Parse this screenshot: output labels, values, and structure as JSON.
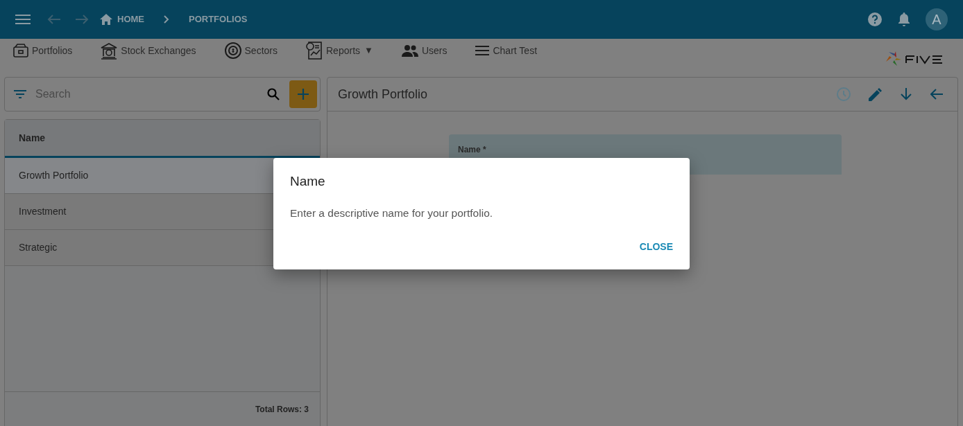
{
  "top_bar": {
    "breadcrumbs": [
      "HOME",
      "PORTFOLIOS"
    ],
    "avatar": "A"
  },
  "menu": [
    {
      "label": "Portfolios",
      "kind": "wallet",
      "dropdown": false
    },
    {
      "label": "Stock Exchanges",
      "kind": "bank",
      "dropdown": false
    },
    {
      "label": "Sectors",
      "kind": "sectors",
      "dropdown": false
    },
    {
      "label": "Reports",
      "kind": "report",
      "dropdown": true,
      "caret": "▼"
    },
    {
      "label": "Users",
      "kind": "users",
      "dropdown": false
    },
    {
      "label": "Chart Test",
      "kind": "lines",
      "dropdown": false
    }
  ],
  "list": {
    "search": {
      "placeholder": "Search"
    },
    "columns": [
      "Name"
    ],
    "rows": [
      {
        "name": "Growth Portfolio",
        "selected": true
      },
      {
        "name": "Investment",
        "selected": false
      },
      {
        "name": "Strategic",
        "selected": false
      }
    ],
    "footer": "Total Rows: 3"
  },
  "detail": {
    "title": "Growth Portfolio",
    "field": {
      "label": "Name *"
    }
  },
  "dialog": {
    "title": "Name",
    "message": "Enter a descriptive name for your portfolio.",
    "button": "CLOSE"
  }
}
